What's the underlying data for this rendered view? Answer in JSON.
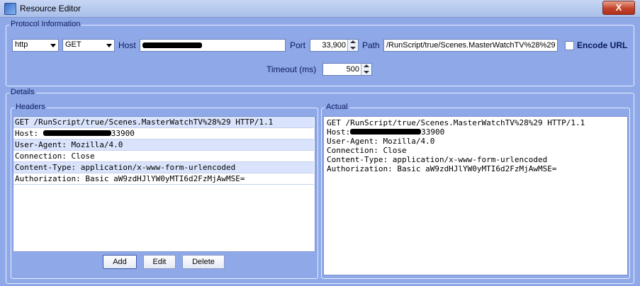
{
  "window": {
    "title": "Resource Editor",
    "close_label": "X"
  },
  "protocol": {
    "group_label": "Protocol Information",
    "scheme": "http",
    "method": "GET",
    "host_label": "Host",
    "port_label": "Port",
    "port_value": "33,900",
    "path_label": "Path",
    "path_value": "/RunScript/true/Scenes.MasterWatchTV%28%29",
    "encode_label": "Encode URL",
    "encode_checked": false,
    "timeout_label": "Timeout (ms)",
    "timeout_value": "500"
  },
  "details": {
    "group_label": "Details",
    "headers": {
      "group_label": "Headers",
      "rows": [
        {
          "text": "GET /RunScript/true/Scenes.MasterWatchTV%28%29 HTTP/1.1"
        },
        {
          "text": "Host:",
          "suffix": "33900"
        },
        {
          "text": "User-Agent: Mozilla/4.0"
        },
        {
          "text": "Connection: Close"
        },
        {
          "text": "Content-Type: application/x-www-form-urlencoded"
        },
        {
          "text": "Authorization: Basic aW9zdHJlYW0yMTI6d2FzMjAwMSE="
        }
      ],
      "buttons": {
        "add": "Add",
        "edit": "Edit",
        "delete": "Delete"
      }
    },
    "actual": {
      "group_label": "Actual",
      "lines": [
        {
          "text": "GET /RunScript/true/Scenes.MasterWatchTV%28%29 HTTP/1.1"
        },
        {
          "text": "Host:",
          "suffix": "33900"
        },
        {
          "text": "User-Agent: Mozilla/4.0"
        },
        {
          "text": "Connection: Close"
        },
        {
          "text": "Content-Type: application/x-www-form-urlencoded"
        },
        {
          "text": "Authorization: Basic aW9zdHJlYW0yMTI6d2FzMjAwMSE="
        }
      ]
    }
  },
  "colors": {
    "window_bg": "#8fa8e8",
    "label_text": "#0b1a5c",
    "row_alt": "#d9e3fb"
  }
}
